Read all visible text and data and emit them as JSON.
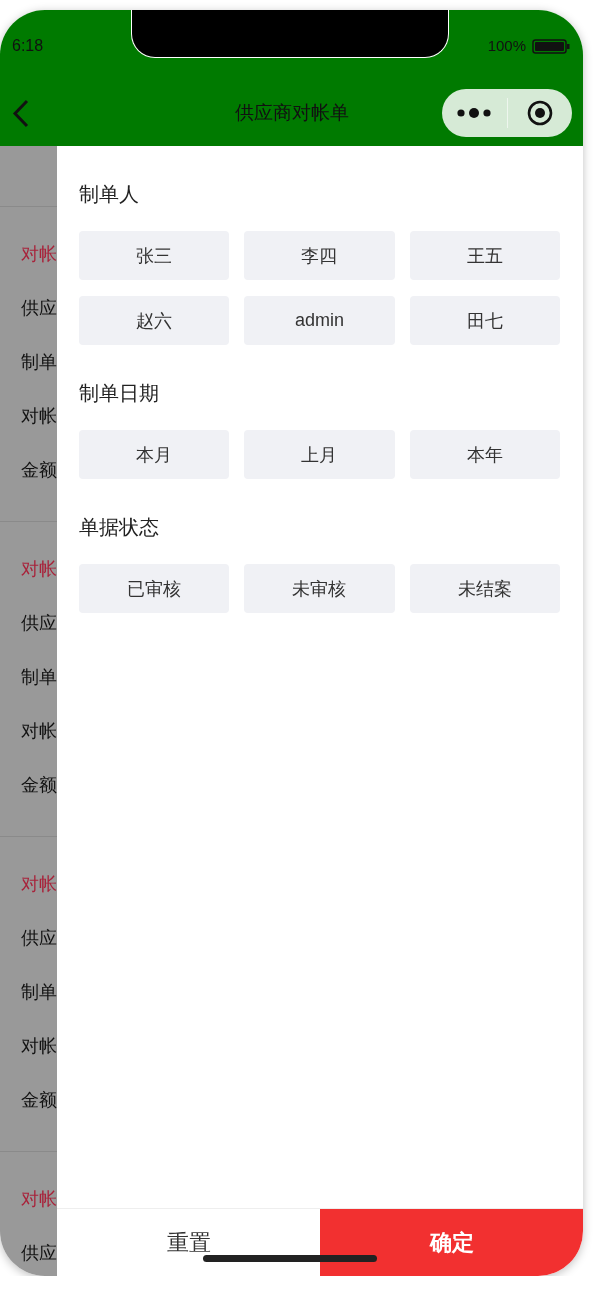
{
  "status_bar": {
    "time": "6:18",
    "battery": "100%"
  },
  "nav_bar": {
    "title": "供应商对帐单"
  },
  "background_list": [
    {
      "title": "对帐",
      "fields": [
        "供应",
        "制单",
        "对帐",
        "金额"
      ]
    },
    {
      "title": "对帐",
      "fields": [
        "供应",
        "制单",
        "对帐",
        "金额"
      ]
    },
    {
      "title": "对帐",
      "fields": [
        "供应",
        "制单",
        "对帐",
        "金额"
      ]
    },
    {
      "title": "对帐",
      "fields": [
        "供应"
      ]
    }
  ],
  "filters": [
    {
      "title": "制单人",
      "options": [
        {
          "label": "张三",
          "selected": false
        },
        {
          "label": "李四",
          "selected": false
        },
        {
          "label": "王五",
          "selected": false
        },
        {
          "label": "赵六",
          "selected": false
        },
        {
          "label": "admin",
          "selected": false
        },
        {
          "label": "田七",
          "selected": false
        }
      ]
    },
    {
      "title": "制单日期",
      "options": [
        {
          "label": "本月",
          "selected": false
        },
        {
          "label": "上月",
          "selected": false
        },
        {
          "label": "本年",
          "selected": false
        }
      ]
    },
    {
      "title": "单据状态",
      "options": [
        {
          "label": "已审核",
          "selected": false
        },
        {
          "label": "未审核",
          "selected": false
        },
        {
          "label": "未结案",
          "selected": false
        }
      ]
    }
  ],
  "footer": {
    "reset": "重置",
    "confirm": "确定"
  }
}
